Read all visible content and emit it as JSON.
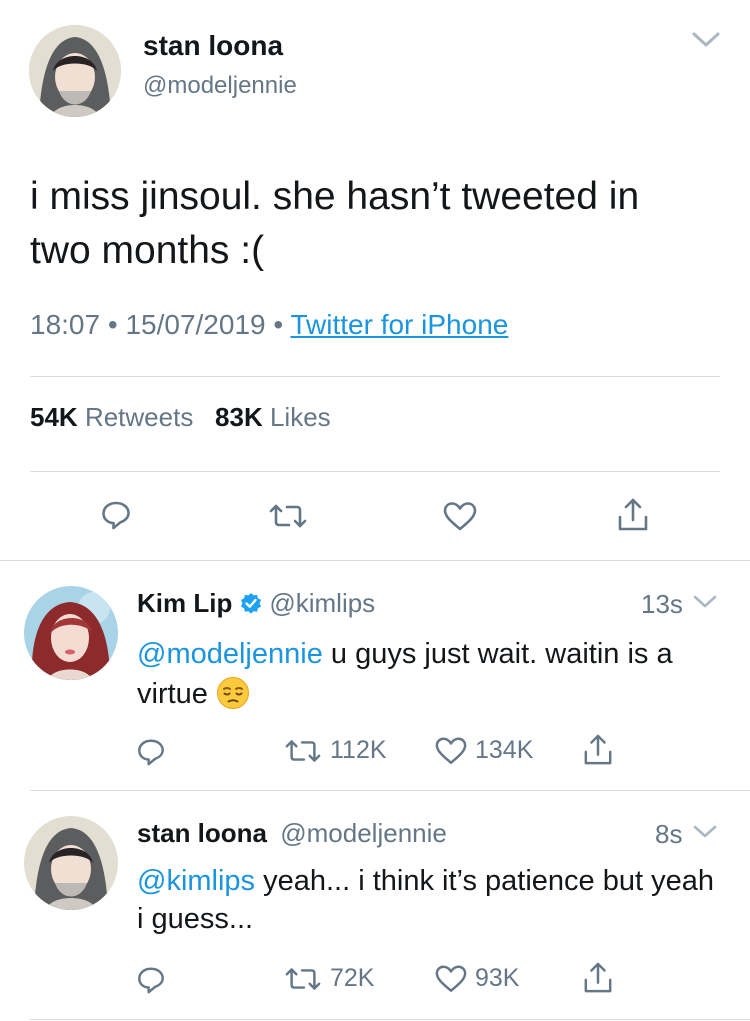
{
  "main_tweet": {
    "display_name": "stan loona",
    "handle": "@modeljennie",
    "text": "i miss jinsoul. she hasn’t tweeted in two months :(",
    "time": "18:07",
    "separator": "•",
    "date": "15/07/2019",
    "source": "Twitter for iPhone",
    "retweets_count": "54K",
    "retweets_label": "Retweets",
    "likes_count": "83K",
    "likes_label": "Likes"
  },
  "replies": [
    {
      "display_name": "Kim Lip",
      "verified": true,
      "handle": "@kimlips",
      "time": "13s",
      "mention": "@modeljennie",
      "text": " u guys just wait. waitin is a virtue ",
      "emoji": "pensive-face",
      "retweets": "112K",
      "likes": "134K"
    },
    {
      "display_name": "stan loona",
      "verified": false,
      "handle": "@modeljennie",
      "time": "8s",
      "mention": "@kimlips",
      "text": " yeah... i think it’s patience but yeah i guess...",
      "retweets": "72K",
      "likes": "93K"
    }
  ],
  "colors": {
    "text": "#14171a",
    "secondary": "#657786",
    "link": "#1b95e0",
    "divider": "#d9dde1",
    "verified": "#1da1f2"
  }
}
